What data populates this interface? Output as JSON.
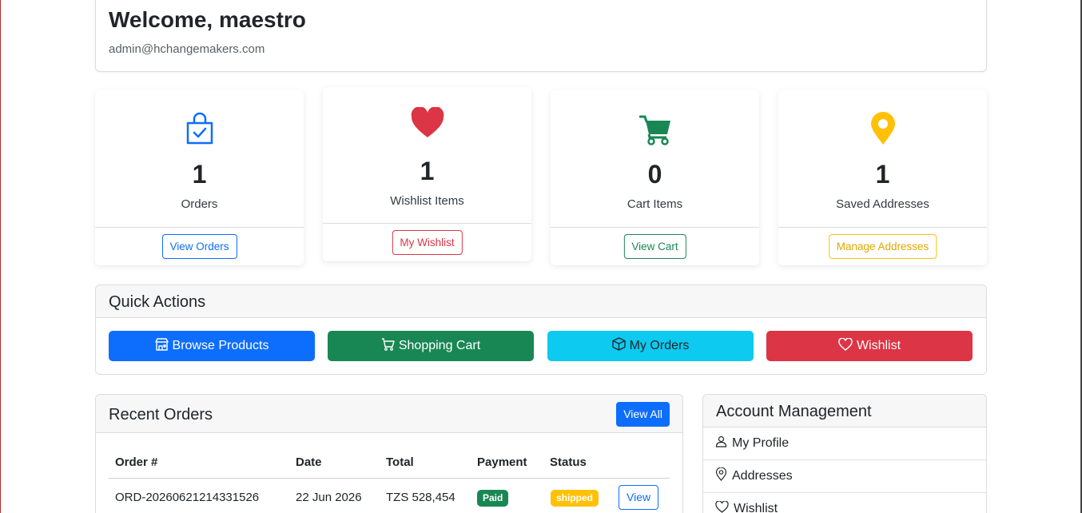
{
  "welcome": {
    "title": "Welcome, maestro",
    "email": "admin@hchangemakers.com"
  },
  "stats": [
    {
      "icon": "shopping-bag-check-icon",
      "value": "1",
      "label": "Orders",
      "button": "View Orders",
      "color": "#0d6efd"
    },
    {
      "icon": "heart-icon",
      "value": "1",
      "label": "Wishlist Items",
      "button": "My Wishlist",
      "color": "#dc3545"
    },
    {
      "icon": "cart-icon",
      "value": "0",
      "label": "Cart Items",
      "button": "View Cart",
      "color": "#198754"
    },
    {
      "icon": "map-pin-icon",
      "value": "1",
      "label": "Saved Addresses",
      "button": "Manage Addresses",
      "color": "#ffc107"
    }
  ],
  "quick_actions": {
    "title": "Quick Actions",
    "buttons": [
      {
        "label": "Browse Products",
        "icon": "shop-icon",
        "color": "#0d6efd"
      },
      {
        "label": "Shopping Cart",
        "icon": "cart-outline-icon",
        "color": "#198754"
      },
      {
        "label": "My Orders",
        "icon": "box-icon",
        "color": "#0dcaf0"
      },
      {
        "label": "Wishlist",
        "icon": "heart-outline-icon",
        "color": "#dc3545"
      }
    ]
  },
  "recent_orders": {
    "title": "Recent Orders",
    "view_all": "View All",
    "columns": [
      "Order #",
      "Date",
      "Total",
      "Payment",
      "Status"
    ],
    "rows": [
      {
        "order": "ORD-20260621214331526",
        "date": "22 Jun 2026",
        "total": "TZS 528,454",
        "payment": "Paid",
        "status": "shipped",
        "action": "View"
      }
    ]
  },
  "account": {
    "title": "Account Management",
    "items": [
      {
        "label": "My Profile",
        "icon": "person-icon"
      },
      {
        "label": "Addresses",
        "icon": "location-icon"
      },
      {
        "label": "Wishlist",
        "icon": "heart-outline-icon"
      }
    ]
  }
}
